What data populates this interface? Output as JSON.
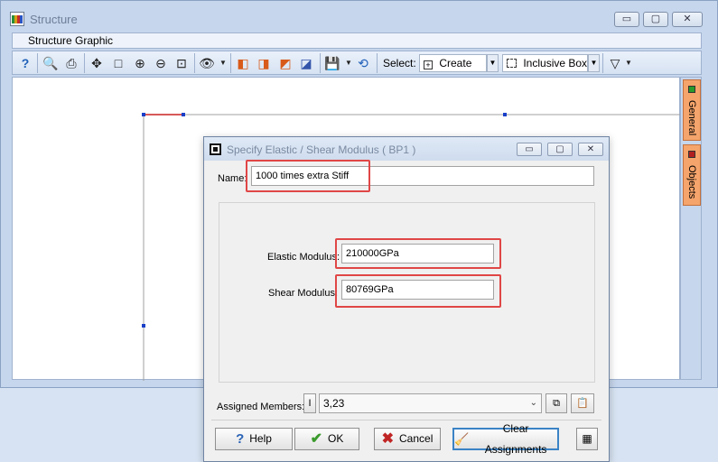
{
  "window": {
    "title": "Structure",
    "minimize": "▭",
    "maximize": "▢",
    "close": "✕"
  },
  "menu": {
    "structure_graphic": "Structure Graphic"
  },
  "toolbar": {
    "select_label": "Select:",
    "create_value": "Create",
    "inclusive_value": "Inclusive Box",
    "icons": [
      "help-icon",
      "print-preview-icon",
      "print-icon",
      "move-icon",
      "box-icon",
      "zoom-in-icon",
      "zoom-out-icon",
      "zoom-fit-icon",
      "view-icon",
      "cube1-icon",
      "cube2-icon",
      "cube3-icon",
      "cube4-icon",
      "save-icon",
      "refresh-icon",
      "filter-icon"
    ]
  },
  "side_tabs": [
    {
      "label": "General",
      "color": "#2a9a2a"
    },
    {
      "label": "Objects",
      "color": "#b02020"
    }
  ],
  "dialog": {
    "title": "Specify Elastic / Shear Modulus ( BP1 )",
    "name_label": "Name:",
    "name_value": "1000 times extra Stiff",
    "elastic_label": "Elastic Modulus:",
    "elastic_value": "210000GPa",
    "shear_label": "Shear Modulus:",
    "shear_value": "80769GPa",
    "assigned_label": "Assigned Members:",
    "assigned_value": "3,23",
    "buttons": {
      "help": "Help",
      "ok": "OK",
      "cancel": "Cancel",
      "clear": "Clear Assignments"
    }
  },
  "colors": {
    "highlight": "#e04646",
    "accent": "#3b83c5"
  }
}
